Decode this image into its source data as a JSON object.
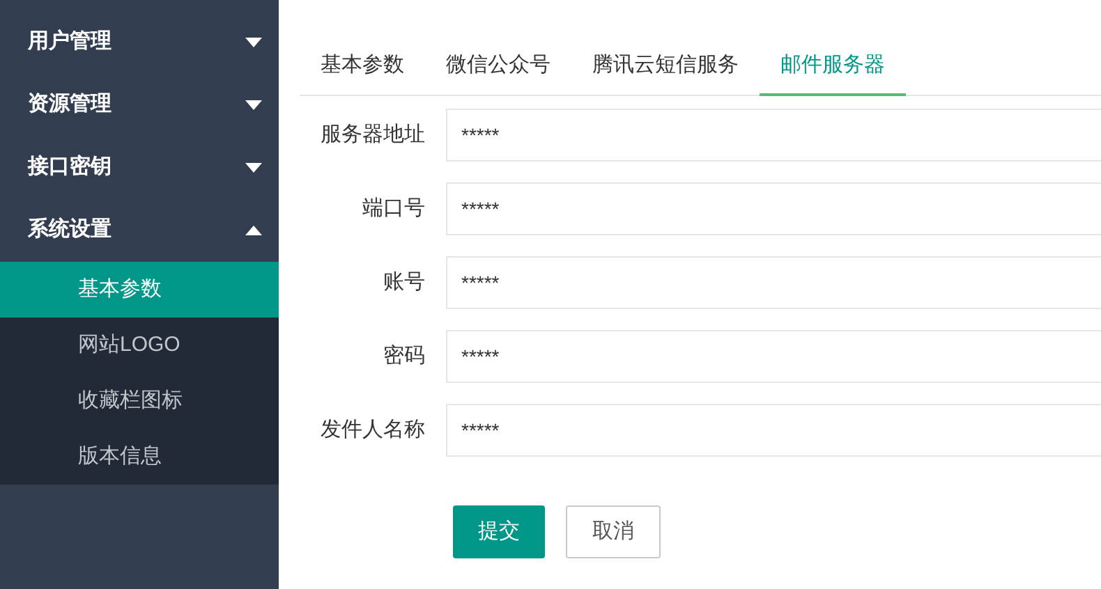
{
  "sidebar": {
    "items": [
      {
        "label": "用户管理",
        "expanded": false
      },
      {
        "label": "资源管理",
        "expanded": false
      },
      {
        "label": "接口密钥",
        "expanded": false
      },
      {
        "label": "系统设置",
        "expanded": true,
        "children": [
          {
            "label": "基本参数",
            "selected": true
          },
          {
            "label": "网站LOGO",
            "selected": false
          },
          {
            "label": "收藏栏图标",
            "selected": false
          },
          {
            "label": "版本信息",
            "selected": false
          }
        ]
      }
    ]
  },
  "tabs": [
    {
      "label": "基本参数",
      "selected": false
    },
    {
      "label": "微信公众号",
      "selected": false
    },
    {
      "label": "腾讯云短信服务",
      "selected": false
    },
    {
      "label": "邮件服务器",
      "selected": true
    }
  ],
  "form": {
    "fields": [
      {
        "label": "服务器地址",
        "value": "*****"
      },
      {
        "label": "端口号",
        "value": "*****"
      },
      {
        "label": "账号",
        "value": "*****"
      },
      {
        "label": "密码",
        "value": "*****"
      },
      {
        "label": "发件人名称",
        "value": "*****"
      }
    ],
    "buttons": [
      {
        "label": "提交",
        "kind": "primary"
      },
      {
        "label": "取消",
        "kind": "secondary"
      }
    ]
  }
}
